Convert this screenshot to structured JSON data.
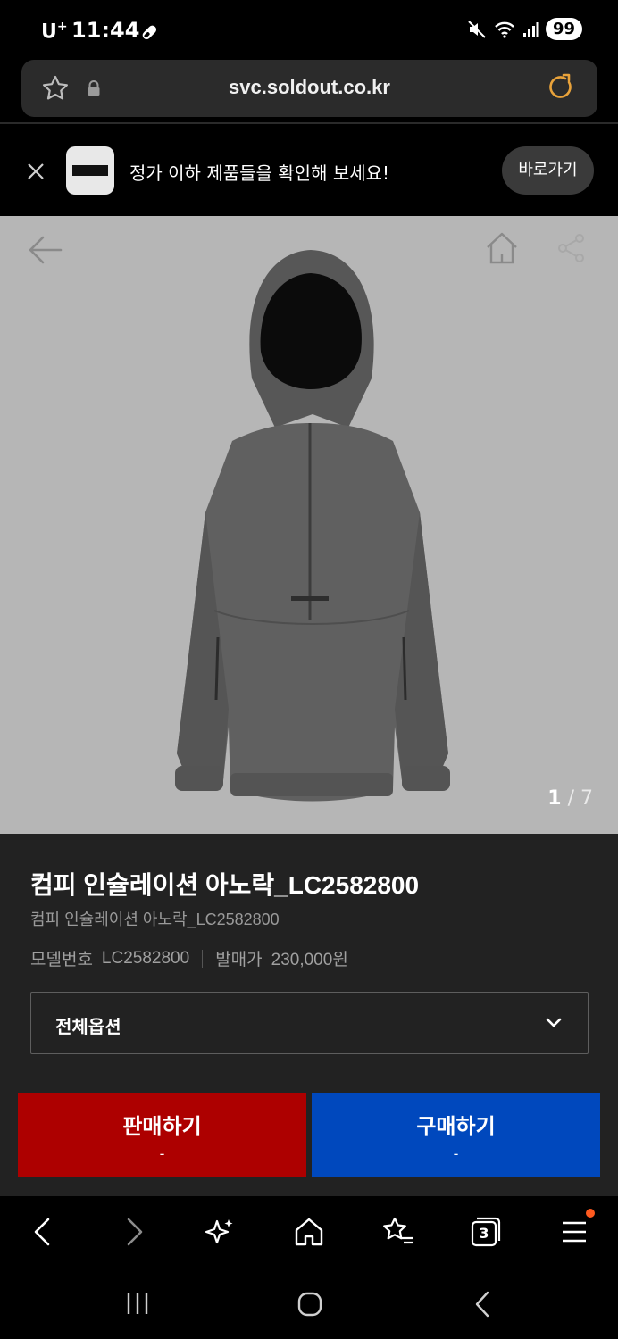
{
  "status_bar": {
    "carrier": "U",
    "carrier_sup": "+",
    "time": "11:44",
    "battery": "99"
  },
  "browser": {
    "url": "svc.soldout.co.kr"
  },
  "promo": {
    "text": "정가 이하 제품들을 확인해 보세요!",
    "button_label": "바로가기"
  },
  "gallery": {
    "current_page": "1",
    "separator": " / ",
    "total_pages": "7"
  },
  "product": {
    "title": "컴피 인슐레이션 아노락_LC2582800",
    "subtitle": "컴피 인슐레이션 아노락_LC2582800",
    "model_label": "모델번호",
    "model_value": "LC2582800",
    "release_price_label": "발매가",
    "release_price_value": "230,000원"
  },
  "option_select": {
    "label": "전체옵션"
  },
  "actions": {
    "sell_label": "판매하기",
    "sell_price": "-",
    "buy_label": "구매하기",
    "buy_price": "-"
  },
  "toolbar": {
    "tab_count": "3"
  },
  "colors": {
    "sell": "#ad0000",
    "buy": "#0048bd",
    "image_bg": "#b6b6b6",
    "panel_bg": "#222222",
    "notification_dot": "#ff5a1f"
  }
}
